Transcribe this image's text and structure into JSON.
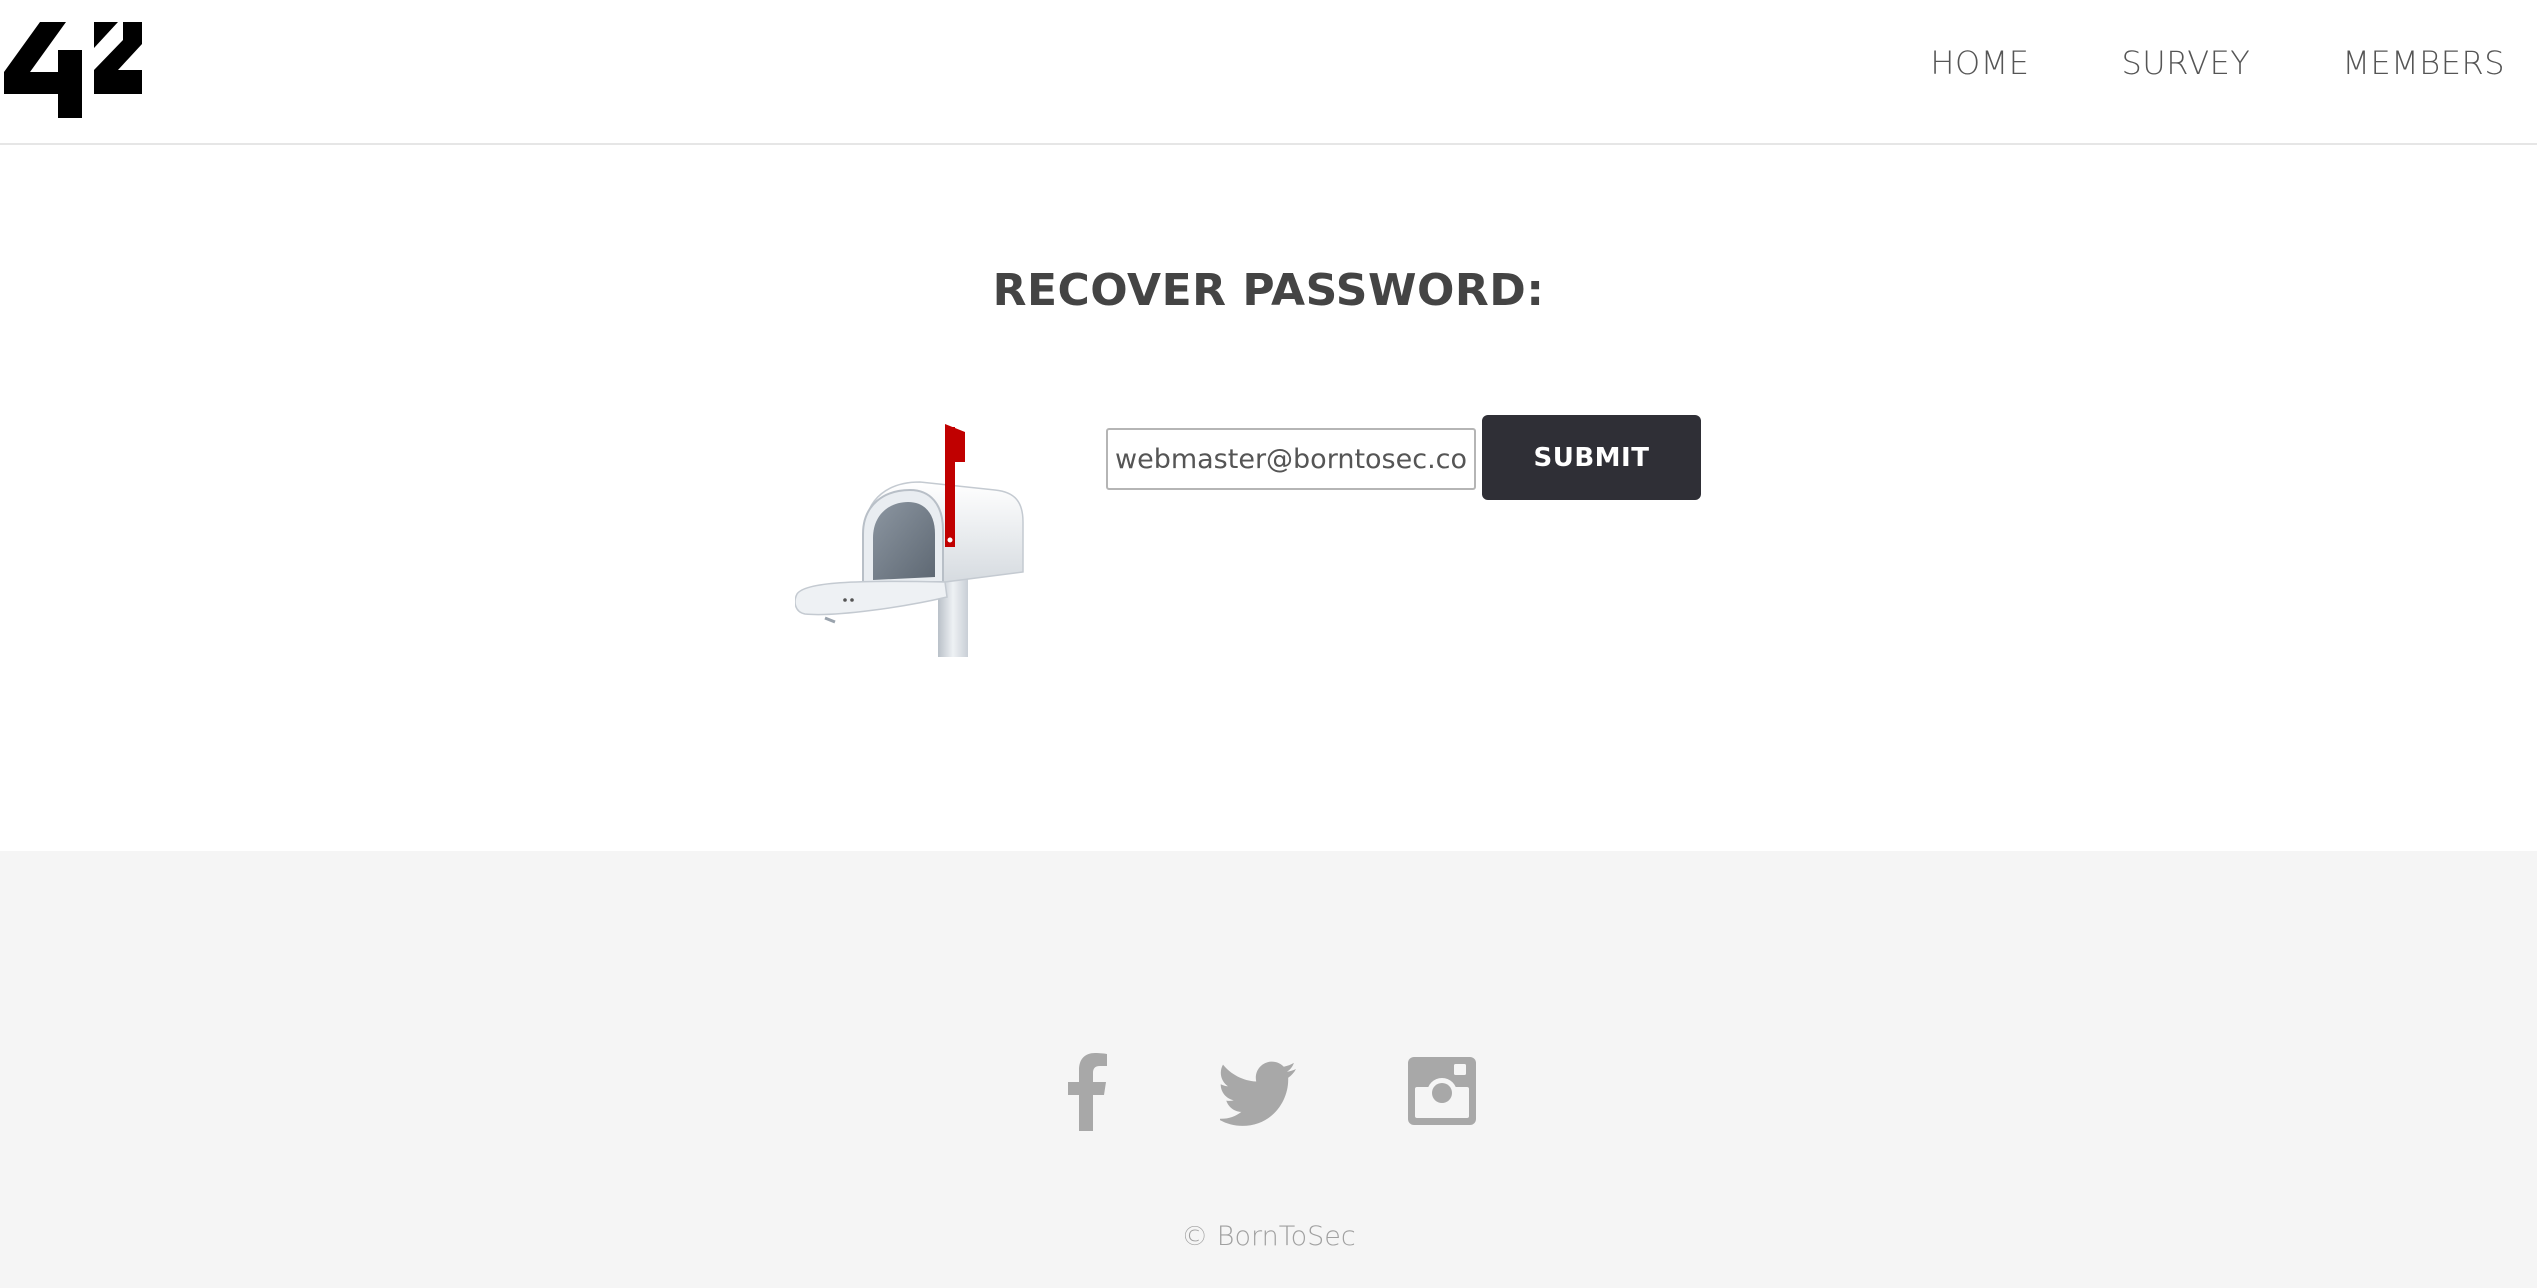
{
  "header": {
    "logo_icon": "42-logo-icon",
    "nav": [
      {
        "label": "HOME"
      },
      {
        "label": "SURVEY"
      },
      {
        "label": "MEMBERS"
      }
    ]
  },
  "main": {
    "title": "RECOVER PASSWORD:",
    "illustration": "mailbox-illustration",
    "email_value": "webmaster@borntosec.com",
    "submit_label": "SUBMIT"
  },
  "footer": {
    "social_icons": [
      "facebook-icon",
      "twitter-icon",
      "instagram-icon"
    ],
    "copyright": "© BornToSec"
  },
  "colors": {
    "button_bg": "#2f2f36",
    "text_dark": "#444444",
    "footer_bg": "#f5f5f5",
    "social_icon": "#a8a8a8",
    "mailbox_flag": "#d40000"
  }
}
